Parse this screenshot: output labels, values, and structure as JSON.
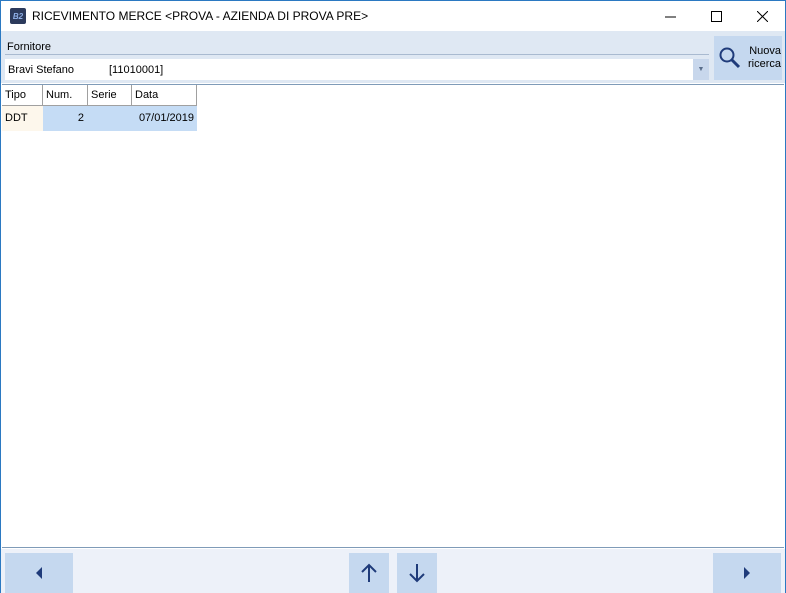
{
  "window": {
    "title": "RICEVIMENTO MERCE <PROVA - AZIENDA DI PROVA PRE>",
    "icon_text": "B2"
  },
  "header": {
    "fornitore_label": "Fornitore",
    "fornitore_name": "Bravi Stefano",
    "fornitore_code": "[11010001]",
    "search_button_line1": "Nuova",
    "search_button_line2": "ricerca"
  },
  "table": {
    "columns": [
      "Tipo",
      "Num.",
      "Serie",
      "Data"
    ],
    "rows": [
      {
        "tipo": "DDT",
        "num": "2",
        "serie": "",
        "data": "07/01/2019"
      }
    ]
  },
  "colors": {
    "accent": "#c5d8ef",
    "header_bg": "#dfe8f3",
    "selection": "#c5dcf5"
  }
}
